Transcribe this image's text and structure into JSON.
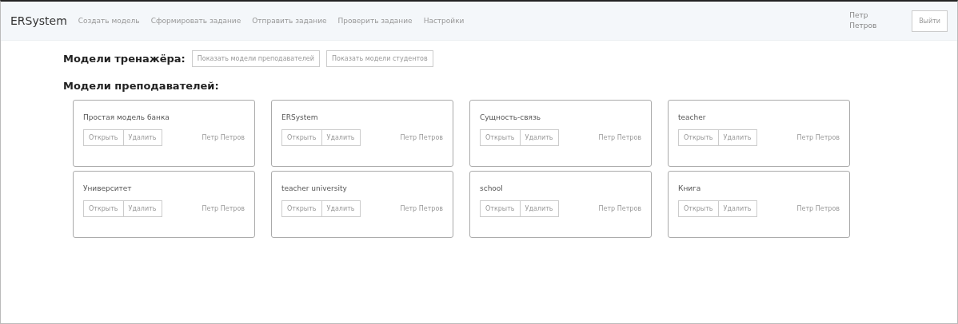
{
  "navbar": {
    "brand": "ERSystem",
    "links": [
      "Создать модель",
      "Сформировать задание",
      "Отправить задание",
      "Проверить задание",
      "Настройки"
    ],
    "user": "Петр Петров",
    "logout": "Выйти"
  },
  "toolbar": {
    "label": "Модели тренажёра:",
    "buttons": [
      "Показать модели преподавателей",
      "Показать модели студентов"
    ]
  },
  "section_title": "Модели преподавателей:",
  "models": [
    {
      "name": "Простая модель банка",
      "open": "Открыть",
      "delete": "Удалить",
      "author": "Петр Петров"
    },
    {
      "name": "ERSystem",
      "open": "Открыть",
      "delete": "Удалить",
      "author": "Петр Петров"
    },
    {
      "name": "Сущность-связь",
      "open": "Открыть",
      "delete": "Удалить",
      "author": "Петр Петров"
    },
    {
      "name": "teacher",
      "open": "Открыть",
      "delete": "Удалить",
      "author": "Петр Петров"
    },
    {
      "name": "Университет",
      "open": "Открыть",
      "delete": "Удалить",
      "author": "Петр Петров"
    },
    {
      "name": "teacher university",
      "open": "Открыть",
      "delete": "Удалить",
      "author": "Петр Петров"
    },
    {
      "name": "school",
      "open": "Открыть",
      "delete": "Удалить",
      "author": "Петр Петров"
    },
    {
      "name": "Книга",
      "open": "Открыть",
      "delete": "Удалить",
      "author": "Петр Петров"
    }
  ]
}
